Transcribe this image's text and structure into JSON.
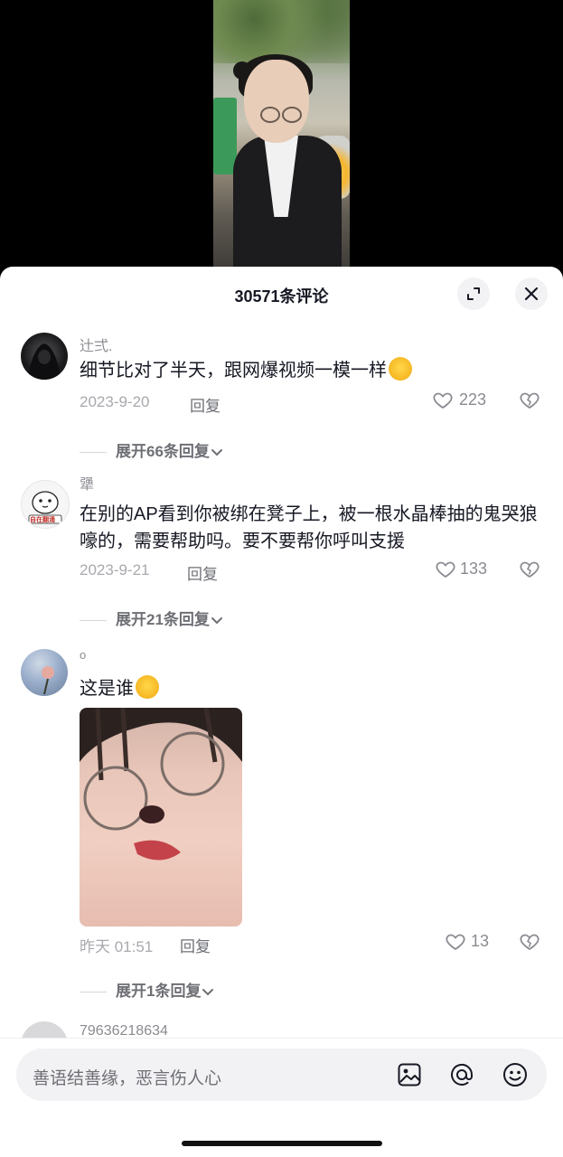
{
  "header": {
    "title": "30571条评论"
  },
  "comments": [
    {
      "username": "辻弍.",
      "text": "细节比对了半天，跟网爆视频一模一样",
      "date": "2023-9-20",
      "reply_label": "回复",
      "likes": "223",
      "expand": "展开66条回复",
      "emoji": "rolling-laughing-emoji"
    },
    {
      "username": "犟",
      "text": "在别的AP看到你被绑在凳子上，被一根水晶棒抽的鬼哭狼嚎的，需要帮助吗。要不要帮你呼叫支援",
      "date": "2023-9-21",
      "reply_label": "回复",
      "likes": "133",
      "expand": "展开21条回复",
      "avatar_text": "自在翻涌"
    },
    {
      "username": "o",
      "text": "这是谁",
      "date": "昨天 01:51",
      "reply_label": "回复",
      "likes": "13",
      "expand": "展开1条回复",
      "emoji": "smirk-emoji"
    },
    {
      "username": "79636218634"
    }
  ],
  "input": {
    "placeholder": "善语结善缘，恶言伤人心"
  },
  "icons": [
    "expand-icon",
    "close-icon",
    "heart-icon",
    "broken-heart-icon",
    "image-icon",
    "at-icon",
    "emoji-icon",
    "chevron-down-icon"
  ],
  "colors": {
    "text": "#161823",
    "muted": "#8a8b91",
    "background": "#ffffff",
    "input_bg": "#f2f2f4"
  }
}
